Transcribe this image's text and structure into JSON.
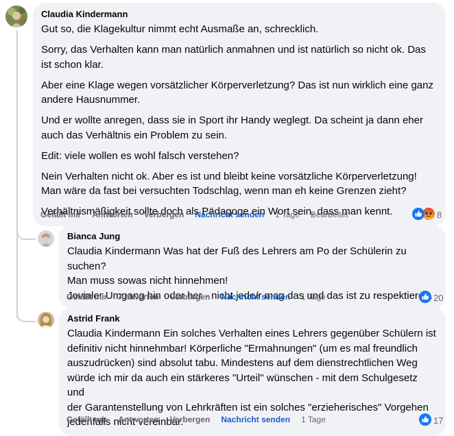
{
  "comment": {
    "author": "Claudia Kindermann",
    "paragraphs": [
      "Gut so, die Klagekultur nimmt echt Ausmaße an, schrecklich.",
      "Sorry, das Verhalten kann man natürlich anmahnen und ist natürlich so nicht ok. Das ist schon klar.",
      "Aber eine Klage wegen vorsätzlicher Körperverletzung? Das ist nun wirklich eine ganz andere Hausnummer.",
      "Und er wollte anregen, dass sie in Sport ihr Handy weglegt. Da scheint ja dann eher auch das Verhältnis ein Problem zu sein.",
      "Edit: viele wollen es wohl falsch verstehen?",
      "Nein Verhalten nicht ok. Aber es ist und bleibt keine vorsätzliche Körperverletzung! Man wäre da fast bei versuchten Todschlag, wenn man eh keine Grenzen zieht?",
      "Verhältnismäßigkeit sollte doch als Pädagoge ein Wort sein, dass man kennt."
    ],
    "actions": {
      "like": "Gefällt mir",
      "reply": "Antworten",
      "hide": "Verbergen",
      "message": "Nachricht senden",
      "time": "1 Tage",
      "edited": "Bearbeitet"
    },
    "reaction_count": "8",
    "reaction_icons": [
      "like-icon",
      "angry-icon"
    ]
  },
  "replies": [
    {
      "author": "Bianca Jung",
      "mention": "Claudia Kindermann",
      "text_lines": [
        " Was hat der Fuß des Lehrers am Po der Schülerin zu suchen?",
        "Man muss sowas nicht hinnehmen!",
        "Jovialer Umgang hin oder her - nicht jede/r mag das und das ist zu respektieren."
      ],
      "actions": {
        "like": "Gefällt mir",
        "reply": "Antworten",
        "hide": "Verbergen",
        "message": "Nachricht senden",
        "time": "1 Tage"
      },
      "reaction_count": "20"
    },
    {
      "author": "Astrid Frank",
      "mention": "Claudia Kindermann",
      "text_lines": [
        " Ein solches Verhalten eines Lehrers gegenüber Schülern ist",
        "definitiv nicht hinnehmbar! Körperliche \"Ermahnungen\" (um es mal freundlich",
        "auszudrücken) sind absolut tabu. Mindestens auf dem dienstrechtlichen Weg",
        "würde ich mir da auch ein stärkeres \"Urteil\" wünschen - mit dem Schulgesetz und",
        "der Garantenstellung von Lehrkräften ist ein solches \"erzieherisches\" Vorgehen",
        "jedenfalls nicht vereinbar."
      ],
      "actions": {
        "like": "Gefällt mir",
        "reply": "Antworten",
        "hide": "Verbergen",
        "message": "Nachricht senden",
        "time": "1 Tage"
      },
      "reaction_count": "17"
    }
  ],
  "colors": {
    "bubble": "#f0f2f5",
    "link_blue": "#1b5ccf",
    "like_blue": "#1877f2",
    "angry": "#e9710f",
    "meta_gray": "#65676b"
  }
}
